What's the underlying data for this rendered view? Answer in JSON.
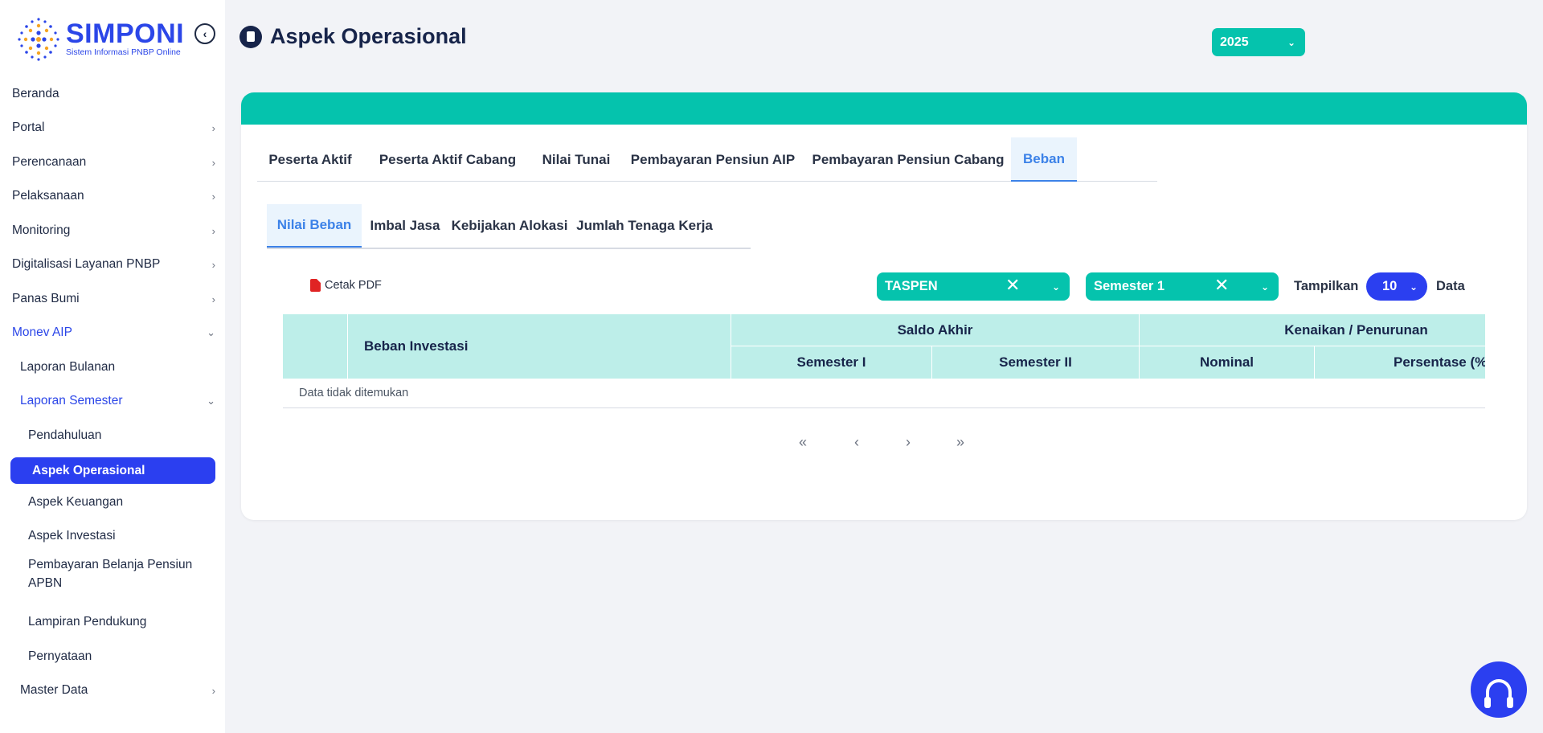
{
  "app": {
    "logo_title": "SIMPONI",
    "logo_subtitle": "Sistem Informasi PNBP Online"
  },
  "sidebar": {
    "items": [
      {
        "label": "Beranda",
        "level": 0,
        "chevron": false
      },
      {
        "label": "Portal",
        "level": 0,
        "chevron": "right"
      },
      {
        "label": "Perencanaan",
        "level": 0,
        "chevron": "right"
      },
      {
        "label": "Pelaksanaan",
        "level": 0,
        "chevron": "right"
      },
      {
        "label": "Monitoring",
        "level": 0,
        "chevron": "right"
      },
      {
        "label": "Digitalisasi Layanan PNBP",
        "level": 0,
        "chevron": "right"
      },
      {
        "label": "Panas Bumi",
        "level": 0,
        "chevron": "right"
      },
      {
        "label": "Monev AIP",
        "level": 0,
        "chevron": "down",
        "state": "expanded"
      },
      {
        "label": "Laporan Bulanan",
        "level": 1,
        "chevron": false
      },
      {
        "label": "Laporan Semester",
        "level": 1,
        "chevron": "down",
        "state": "expanded"
      },
      {
        "label": "Pendahuluan",
        "level": 2,
        "chevron": false
      },
      {
        "label": "Aspek Operasional",
        "level": 2,
        "chevron": false,
        "state": "active"
      },
      {
        "label": "Aspek Keuangan",
        "level": 2,
        "chevron": false
      },
      {
        "label": "Aspek Investasi",
        "level": 2,
        "chevron": false
      },
      {
        "label": "Pembayaran Belanja Pensiun",
        "label_line2": "APBN",
        "level": 2,
        "chevron": false
      },
      {
        "label": "Lampiran Pendukung",
        "level": 2,
        "chevron": false
      },
      {
        "label": "Pernyataan",
        "level": 2,
        "chevron": false
      },
      {
        "label": "Master Data",
        "level": 1,
        "chevron": "right"
      }
    ]
  },
  "header": {
    "page_title": "Aspek Operasional",
    "year_value": "2025"
  },
  "tabs_primary": [
    {
      "label": "Peserta Aktif"
    },
    {
      "label": "Peserta Aktif Cabang"
    },
    {
      "label": "Nilai Tunai"
    },
    {
      "label": "Pembayaran Pensiun AIP"
    },
    {
      "label": "Pembayaran Pensiun Cabang"
    },
    {
      "label": "Beban",
      "active": true
    }
  ],
  "tabs_secondary": [
    {
      "label": "Nilai Beban",
      "active": true
    },
    {
      "label": "Imbal Jasa"
    },
    {
      "label": "Kebijakan Alokasi"
    },
    {
      "label": "Jumlah Tenaga Kerja"
    }
  ],
  "toolbar": {
    "print_pdf_label": "Cetak PDF",
    "filter_entity_value": "TASPEN",
    "filter_period_value": "Semester 1",
    "show_label": "Tampilkan",
    "page_size_value": "10",
    "data_label": "Data"
  },
  "table": {
    "headers": {
      "col_main": "Beban Investasi",
      "group_saldo": "Saldo Akhir",
      "group_change": "Kenaikan / Penurunan",
      "sem1": "Semester I",
      "sem2": "Semester II",
      "nominal": "Nominal",
      "percent": "Persentase (%"
    },
    "empty_message": "Data tidak ditemukan"
  },
  "pagination": {
    "first": "«",
    "prev": "‹",
    "next": "›",
    "last": "»"
  },
  "colors": {
    "accent_teal": "#05c3ad",
    "accent_blue": "#2b3ff0",
    "tab_active": "#3c82e8",
    "header_fill": "#bdeee9"
  },
  "icons": [
    "collapse-sidebar-icon",
    "chevron-right-icon",
    "chevron-down-icon",
    "clipboard-icon",
    "pdf-icon",
    "clear-icon",
    "headset-icon"
  ]
}
